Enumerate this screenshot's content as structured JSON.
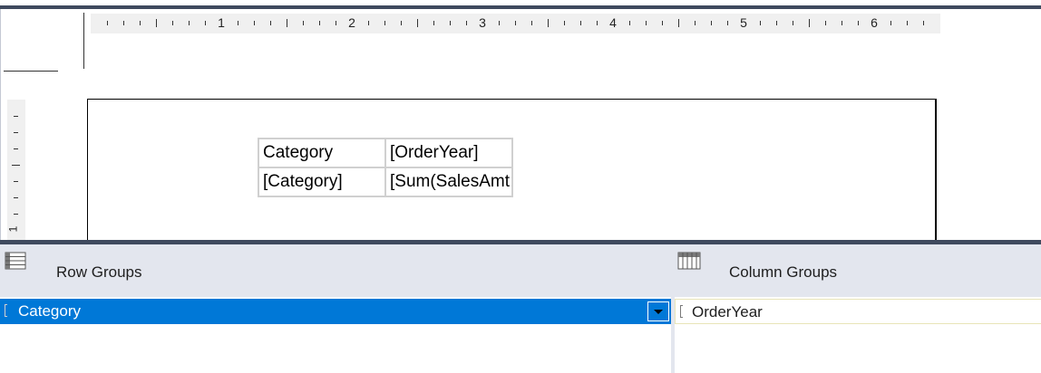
{
  "ruler": {
    "numbers": [
      "1",
      "2",
      "3",
      "4",
      "5",
      "6"
    ],
    "vertical_number": "1"
  },
  "tablix": {
    "rows": [
      [
        "Category",
        "[OrderYear]"
      ],
      [
        "[Category]",
        "[Sum(SalesAmt"
      ]
    ]
  },
  "grouping": {
    "row_groups_title": "Row Groups",
    "column_groups_title": "Column Groups",
    "row_groups": [
      {
        "label": "Category",
        "selected": true
      }
    ],
    "column_groups": [
      {
        "label": "OrderYear",
        "selected": false
      }
    ]
  },
  "colors": {
    "selection": "#0078d7",
    "pane_header": "#e3e6ee",
    "frame_border": "#3f4a5e"
  }
}
